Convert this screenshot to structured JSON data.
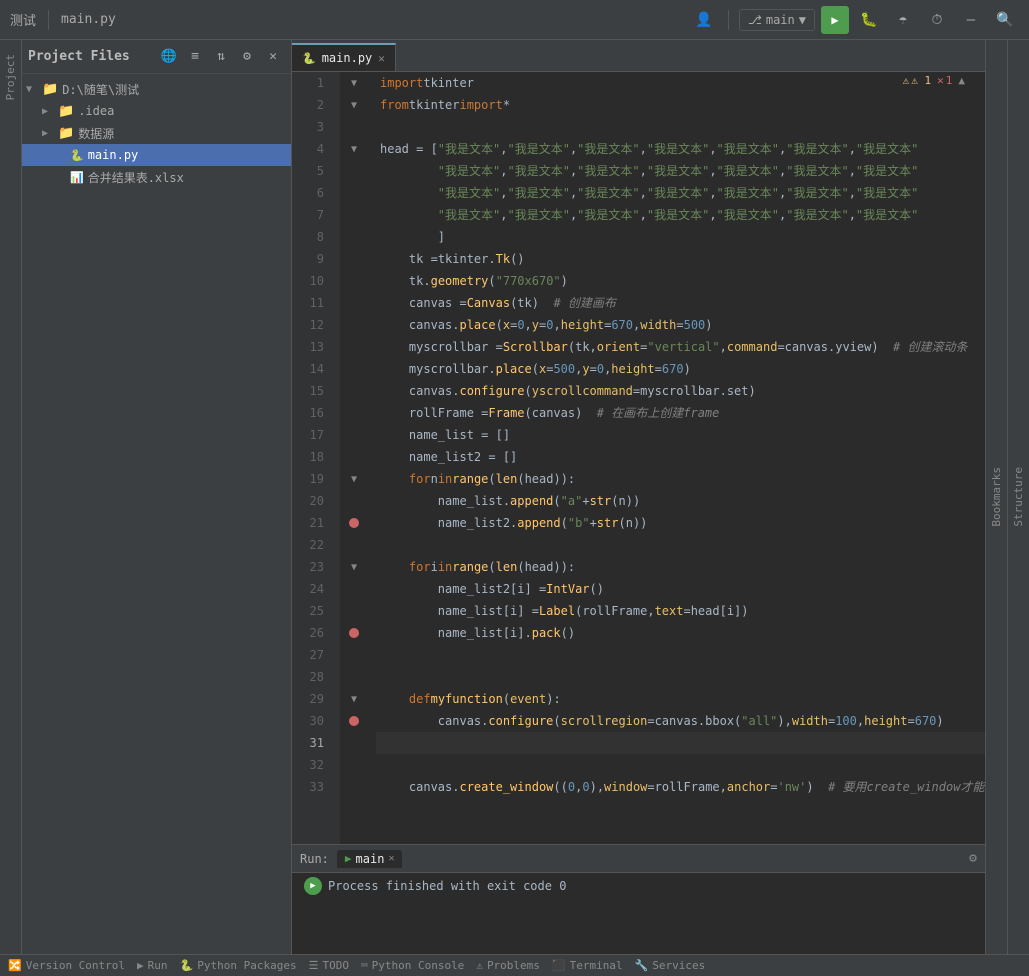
{
  "app": {
    "title": "测试",
    "file": "main.py"
  },
  "topbar": {
    "project_files": "Project Files",
    "branch": "main",
    "run_label": "▶",
    "tab_label": "main.py"
  },
  "sidebar": {
    "root": "D:\\随笔\\测试",
    "items": [
      {
        "label": ".idea",
        "type": "folder",
        "indent": 1,
        "expanded": false
      },
      {
        "label": "数据源",
        "type": "folder",
        "indent": 1,
        "expanded": false
      },
      {
        "label": "main.py",
        "type": "py",
        "indent": 1
      },
      {
        "label": "合并结果表.xlsx",
        "type": "xl",
        "indent": 1
      }
    ]
  },
  "editor": {
    "filename": "main.py",
    "warnings": "⚠ 1",
    "errors": "✕ 1",
    "lines": [
      {
        "num": 1,
        "has_fold": true,
        "content_html": "<span class='kw'>import</span> <span class='normal'>tkinter</span>"
      },
      {
        "num": 2,
        "has_fold": true,
        "content_html": "<span class='kw'>from</span> <span class='normal'>tkinter</span> <span class='kw'>import</span> <span class='normal'>*</span>"
      },
      {
        "num": 3,
        "content_html": ""
      },
      {
        "num": 4,
        "has_fold": true,
        "content_html": "<span class='normal'>head = [</span><span class='str'>\"我是文本\"</span><span class='normal'>, </span><span class='str'>\"我是文本\"</span><span class='normal'>, </span><span class='str'>\"我是文本\"</span><span class='normal'>, </span><span class='str'>\"我是文本\"</span><span class='normal'>, </span><span class='str'>\"我是文本\"</span><span class='normal'>, </span><span class='str'>\"我是文本\"</span><span class='normal'>, </span><span class='str'>\"我是文本\"</span>"
      },
      {
        "num": 5,
        "content_html": "&nbsp;&nbsp;&nbsp;&nbsp;&nbsp;&nbsp;&nbsp;&nbsp;<span class='str'>\"我是文本\"</span><span class='normal'>, </span><span class='str'>\"我是文本\"</span><span class='normal'>, </span><span class='str'>\"我是文本\"</span><span class='normal'>, </span><span class='str'>\"我是文本\"</span><span class='normal'>, </span><span class='str'>\"我是文本\"</span><span class='normal'>, </span><span class='str'>\"我是文本\"</span><span class='normal'>, </span><span class='str'>\"我是文本\"</span>"
      },
      {
        "num": 6,
        "content_html": "&nbsp;&nbsp;&nbsp;&nbsp;&nbsp;&nbsp;&nbsp;&nbsp;<span class='str'>\"我是文本\"</span><span class='normal'>, </span><span class='str'>\"我是文本\"</span><span class='normal'>, </span><span class='str'>\"我是文本\"</span><span class='normal'>, </span><span class='str'>\"我是文本\"</span><span class='normal'>, </span><span class='str'>\"我是文本\"</span><span class='normal'>, </span><span class='str'>\"我是文本\"</span><span class='normal'>, </span><span class='str'>\"我是文本\"</span>"
      },
      {
        "num": 7,
        "content_html": "&nbsp;&nbsp;&nbsp;&nbsp;&nbsp;&nbsp;&nbsp;&nbsp;<span class='str'>\"我是文本\"</span><span class='normal'>, </span><span class='str'>\"我是文本\"</span><span class='normal'>, </span><span class='str'>\"我是文本\"</span><span class='normal'>, </span><span class='str'>\"我是文本\"</span><span class='normal'>, </span><span class='str'>\"我是文本\"</span><span class='normal'>, </span><span class='str'>\"我是文本\"</span><span class='normal'>, </span><span class='str'>\"我是文本\"</span>"
      },
      {
        "num": 8,
        "content_html": "&nbsp;&nbsp;&nbsp;&nbsp;&nbsp;&nbsp;&nbsp;&nbsp;<span class='normal'>]</span>"
      },
      {
        "num": 9,
        "content_html": "&nbsp;&nbsp;&nbsp;&nbsp;<span class='normal'>tk = </span><span class='class-name'>tkinter</span><span class='normal'>.</span><span class='fn'>Tk</span><span class='paren'>()</span>"
      },
      {
        "num": 10,
        "content_html": "&nbsp;&nbsp;&nbsp;&nbsp;<span class='normal'>tk.</span><span class='fn'>geometry</span><span class='paren'>(</span><span class='str'>\"770x670\"</span><span class='paren'>)</span>"
      },
      {
        "num": 11,
        "content_html": "&nbsp;&nbsp;&nbsp;&nbsp;<span class='normal'>canvas = </span><span class='fn'>Canvas</span><span class='paren'>(</span><span class='normal'>tk</span><span class='paren'>)</span>&nbsp;&nbsp;<span class='comment'># 创建画布</span>"
      },
      {
        "num": 12,
        "content_html": "&nbsp;&nbsp;&nbsp;&nbsp;<span class='normal'>canvas.</span><span class='fn'>place</span><span class='paren'>(</span><span class='param'>x</span><span class='normal'>=</span><span class='num'>0</span><span class='normal'>, </span><span class='param'>y</span><span class='normal'>=</span><span class='num'>0</span><span class='normal'>, </span><span class='param'>height</span><span class='normal'>=</span><span class='num'>670</span><span class='normal'>, </span><span class='param'>width</span><span class='normal'>=</span><span class='num'>500</span><span class='paren'>)</span>"
      },
      {
        "num": 13,
        "content_html": "&nbsp;&nbsp;&nbsp;&nbsp;<span class='normal'>myscrollbar = </span><span class='fn'>Scrollbar</span><span class='paren'>(</span><span class='normal'>tk, </span><span class='param'>orient</span><span class='normal'>=</span><span class='str'>\"vertical\"</span><span class='normal'>, </span><span class='param'>command</span><span class='normal'>=canvas.yview</span><span class='paren'>)</span>&nbsp;&nbsp;<span class='comment'># 创建滚动条</span>"
      },
      {
        "num": 14,
        "content_html": "&nbsp;&nbsp;&nbsp;&nbsp;<span class='normal'>myscrollbar.</span><span class='fn'>place</span><span class='paren'>(</span><span class='param'>x</span><span class='normal'>=</span><span class='num'>500</span><span class='normal'>, </span><span class='param'>y</span><span class='normal'>=</span><span class='num'>0</span><span class='normal'>, </span><span class='param'>height</span><span class='normal'>=</span><span class='num'>670</span><span class='paren'>)</span>"
      },
      {
        "num": 15,
        "content_html": "&nbsp;&nbsp;&nbsp;&nbsp;<span class='normal'>canvas.</span><span class='fn'>configure</span><span class='paren'>(</span><span class='param'>yscrollcommand</span><span class='normal'>=myscrollbar.set</span><span class='paren'>)</span>"
      },
      {
        "num": 16,
        "content_html": "&nbsp;&nbsp;&nbsp;&nbsp;<span class='normal'>rollFrame = </span><span class='fn'>Frame</span><span class='paren'>(</span><span class='normal'>canvas</span><span class='paren'>)</span>&nbsp;&nbsp;<span class='comment'># 在画布上创建frame</span>"
      },
      {
        "num": 17,
        "content_html": "&nbsp;&nbsp;&nbsp;&nbsp;<span class='normal'>name_list = []</span>"
      },
      {
        "num": 18,
        "content_html": "&nbsp;&nbsp;&nbsp;&nbsp;<span class='normal'>name_list2 = []</span>"
      },
      {
        "num": 19,
        "has_fold": true,
        "content_html": "&nbsp;&nbsp;&nbsp;&nbsp;<span class='kw'>for</span> <span class='normal'>n</span> <span class='kw'>in</span> <span class='fn'>range</span><span class='paren'>(</span><span class='fn'>len</span><span class='paren'>(</span><span class='normal'>head</span><span class='paren'>))</span><span class='normal'>:</span>"
      },
      {
        "num": 20,
        "content_html": "&nbsp;&nbsp;&nbsp;&nbsp;&nbsp;&nbsp;&nbsp;&nbsp;<span class='normal'>name_list.</span><span class='fn'>append</span><span class='paren'>(</span><span class='str'>\"a\"</span><span class='normal'> + </span><span class='fn'>str</span><span class='paren'>(</span><span class='normal'>n</span><span class='paren'>))</span>"
      },
      {
        "num": 21,
        "has_breakpoint": true,
        "content_html": "&nbsp;&nbsp;&nbsp;&nbsp;&nbsp;&nbsp;&nbsp;&nbsp;<span class='normal'>name_list2.</span><span class='fn'>append</span><span class='paren'>(</span><span class='str'>\"b\"</span><span class='normal'> + </span><span class='fn'>str</span><span class='paren'>(</span><span class='normal'>n</span><span class='paren'>))</span>"
      },
      {
        "num": 22,
        "content_html": ""
      },
      {
        "num": 23,
        "has_fold": true,
        "content_html": "&nbsp;&nbsp;&nbsp;&nbsp;<span class='kw'>for</span> <span class='normal'>i</span> <span class='kw'>in</span> <span class='fn'>range</span><span class='paren'>(</span><span class='fn'>len</span><span class='paren'>(</span><span class='normal'>head</span><span class='paren'>))</span><span class='normal'>:</span>"
      },
      {
        "num": 24,
        "content_html": "&nbsp;&nbsp;&nbsp;&nbsp;&nbsp;&nbsp;&nbsp;&nbsp;<span class='normal'>name_list2[i] = </span><span class='fn'>IntVar</span><span class='paren'>()</span>"
      },
      {
        "num": 25,
        "content_html": "&nbsp;&nbsp;&nbsp;&nbsp;&nbsp;&nbsp;&nbsp;&nbsp;<span class='normal'>name_list[i] = </span><span class='fn'>Label</span><span class='paren'>(</span><span class='normal'>rollFrame, </span><span class='param'>text</span><span class='normal'>=head[i]</span><span class='paren'>)</span>"
      },
      {
        "num": 26,
        "has_breakpoint": true,
        "content_html": "&nbsp;&nbsp;&nbsp;&nbsp;&nbsp;&nbsp;&nbsp;&nbsp;<span class='normal'>name_list[i].</span><span class='fn'>pack</span><span class='paren'>()</span>"
      },
      {
        "num": 27,
        "content_html": ""
      },
      {
        "num": 28,
        "content_html": ""
      },
      {
        "num": 29,
        "has_fold": true,
        "content_html": "&nbsp;&nbsp;&nbsp;&nbsp;<span class='kw'>def</span> <span class='fn'>myfunction</span><span class='paren'>(</span><span class='param'>event</span><span class='paren'>)</span><span class='normal'>:</span>"
      },
      {
        "num": 30,
        "has_breakpoint": true,
        "content_html": "&nbsp;&nbsp;&nbsp;&nbsp;&nbsp;&nbsp;&nbsp;&nbsp;<span class='normal'>canvas.</span><span class='fn'>configure</span><span class='paren'>(</span><span class='param'>scrollregion</span><span class='normal'>=canvas.bbox(</span><span class='str'>\"all\"</span><span class='normal'>), </span><span class='param'>width</span><span class='normal'>=</span><span class='num'>100</span><span class='normal'>, </span><span class='param'>height</span><span class='normal'>=</span><span class='num'>670</span><span class='paren'>)</span>"
      },
      {
        "num": 31,
        "is_active": true,
        "content_html": ""
      },
      {
        "num": 32,
        "content_html": ""
      },
      {
        "num": 33,
        "content_html": "&nbsp;&nbsp;&nbsp;&nbsp;<span class='normal'>canvas.</span><span class='fn'>create_window</span><span class='paren'>(</span><span class='paren'>(</span><span class='num'>0</span><span class='normal'>, </span><span class='num'>0</span><span class='paren'>)</span><span class='normal'>, </span><span class='param'>window</span><span class='normal'>=rollFrame, </span><span class='param'>anchor</span><span class='normal'>=</span><span class='str'>'nw'</span><span class='paren'>)</span>&nbsp;&nbsp;<span class='comment'># 要用create_window才能</span>"
      }
    ]
  },
  "bottom": {
    "tab_label": "main",
    "run_label": "Run:",
    "process_text": "Process finished with exit code 0",
    "settings_icon": "⚙"
  },
  "statusbar": {
    "items": [
      "Version Control",
      "Run",
      "Python Packages",
      "TODO",
      "Python Console",
      "Problems",
      "Terminal",
      "Services"
    ]
  }
}
